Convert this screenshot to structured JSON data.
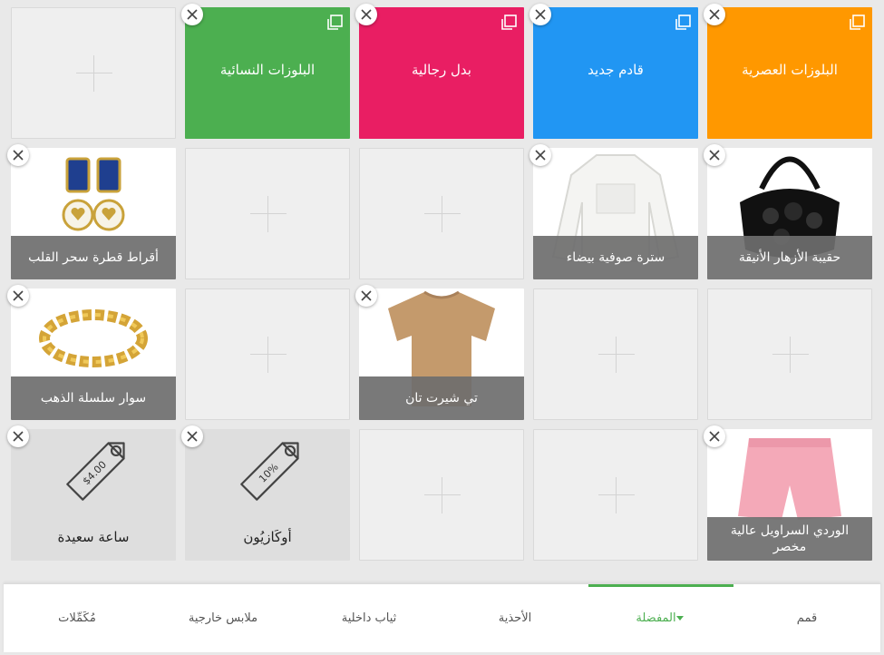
{
  "categories": [
    {
      "label": "البلوزات النسائية",
      "color": "#4caf50"
    },
    {
      "label": "بدل رجالية",
      "color": "#e91e63"
    },
    {
      "label": "قادم جديد",
      "color": "#2196f3"
    },
    {
      "label": "البلوزات العصرية",
      "color": "#ff9800"
    }
  ],
  "products": {
    "earrings": "أقراط قطرة سحر القلب",
    "jacket": "سترة صوفية بيضاء",
    "handbag": "حقيبة الأزهار الأنيقة",
    "bracelet": "سوار سلسلة الذهب",
    "tshirt": "تي شيرت تان",
    "shorts": "الوردي السراويل عالية مخصر"
  },
  "discounts": {
    "happy_hour": {
      "label": "ساعة سعيدة",
      "tag": "$4.00"
    },
    "okazion": {
      "label": "أوكَازيُون",
      "tag": "10%"
    }
  },
  "nav": {
    "tabs": [
      {
        "label": "قمم",
        "active": false
      },
      {
        "label": "المفضلة",
        "active": true
      },
      {
        "label": "الأحذية",
        "active": false
      },
      {
        "label": "ثياب داخلية",
        "active": false
      },
      {
        "label": "ملابس خارجية",
        "active": false
      },
      {
        "label": "مُكَمِّلات",
        "active": false
      }
    ],
    "accent": "#4caf50"
  },
  "icons": {
    "remove": "close-icon",
    "empty": "plus-icon",
    "category": "copy-icon",
    "discount": "price-tag-icon"
  }
}
